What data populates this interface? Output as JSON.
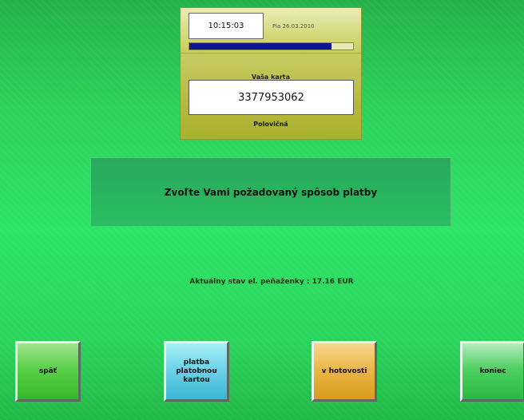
{
  "header": {
    "time": "10:15:03",
    "date": "Pia 26.03.2010",
    "progress": 0.87
  },
  "card": {
    "label": "Vaša karta",
    "number": "3377953062",
    "type": "Polovičná"
  },
  "message": "Zvoľte Vami požadovaný spôsob platby",
  "wallet": "Aktuálny stav el. peňaženky : 17.16 EUR",
  "buttons": {
    "back": "späť",
    "card_payment": "platba\nplatobnou\nkartou",
    "cash": "v hotovosti",
    "end": "koniec"
  },
  "colors": {
    "background": "#2ee366",
    "panel": "#c8cb64",
    "progress_fill": "#0d1590",
    "btn_back": "#5bd04a",
    "btn_card": "#6fd3e9",
    "btn_cash": "#e9b544",
    "btn_end": "#4fd063"
  }
}
